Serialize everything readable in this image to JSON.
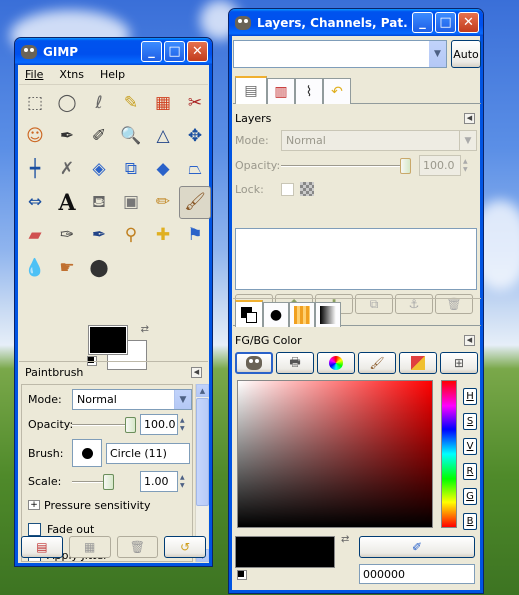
{
  "colors": {
    "title_blue": "#0053ee",
    "face": "#ece9d8",
    "fg": "#000000",
    "bg": "#ffffff"
  },
  "toolbox": {
    "title": "GIMP",
    "menu": [
      "File",
      "Xtns",
      "Help"
    ],
    "tools": [
      {
        "name": "rect-select-icon",
        "glyph": "⬚",
        "color": "#555"
      },
      {
        "name": "ellipse-select-icon",
        "glyph": "◯",
        "color": "#555"
      },
      {
        "name": "free-select-icon",
        "glyph": "ℓ",
        "color": "#666"
      },
      {
        "name": "fuzzy-select-icon",
        "glyph": "✎",
        "color": "#c8a020"
      },
      {
        "name": "select-by-color-icon",
        "glyph": "▦",
        "color": "#d04020"
      },
      {
        "name": "scissors-icon",
        "glyph": "✂",
        "color": "#aa2222"
      },
      {
        "name": "foreground-select-icon",
        "glyph": "☺",
        "color": "#cc6622"
      },
      {
        "name": "paths-icon",
        "glyph": "✒",
        "color": "#333"
      },
      {
        "name": "color-picker-icon",
        "glyph": "✐",
        "color": "#333"
      },
      {
        "name": "zoom-icon",
        "glyph": "🔍",
        "color": "#2255aa"
      },
      {
        "name": "measure-icon",
        "glyph": "△",
        "color": "#224488"
      },
      {
        "name": "move-icon",
        "glyph": "✥",
        "color": "#1a4fa0"
      },
      {
        "name": "align-icon",
        "glyph": "┿",
        "color": "#1a4fa0"
      },
      {
        "name": "crop-icon",
        "glyph": "✗",
        "color": "#666"
      },
      {
        "name": "rotate-icon",
        "glyph": "◈",
        "color": "#2a62c9"
      },
      {
        "name": "scale-icon",
        "glyph": "⧉",
        "color": "#2a62c9"
      },
      {
        "name": "shear-icon",
        "glyph": "◆",
        "color": "#2a62c9"
      },
      {
        "name": "perspective-icon",
        "glyph": "⏢",
        "color": "#2a62c9"
      },
      {
        "name": "flip-icon",
        "glyph": "⇔",
        "color": "#1a4fa0"
      },
      {
        "name": "text-icon",
        "glyph": "A",
        "color": "#111"
      },
      {
        "name": "bucket-fill-icon",
        "glyph": "⛾",
        "color": "#666"
      },
      {
        "name": "blend-icon",
        "glyph": "▣",
        "color": "#777"
      },
      {
        "name": "pencil-icon",
        "glyph": "✏",
        "color": "#c28a2a"
      },
      {
        "name": "paintbrush-icon",
        "glyph": "🖌",
        "color": "#8a5a2a"
      },
      {
        "name": "eraser-icon",
        "glyph": "▰",
        "color": "#d05050"
      },
      {
        "name": "airbrush-icon",
        "glyph": "✑",
        "color": "#444"
      },
      {
        "name": "ink-icon",
        "glyph": "✒",
        "color": "#224488"
      },
      {
        "name": "clone-icon",
        "glyph": "⚲",
        "color": "#c08020"
      },
      {
        "name": "heal-icon",
        "glyph": "✚",
        "color": "#e0b020"
      },
      {
        "name": "perspective-clone-icon",
        "glyph": "⚑",
        "color": "#2a62c9"
      },
      {
        "name": "blur-icon",
        "glyph": "💧",
        "color": "#3a7ad0"
      },
      {
        "name": "smudge-icon",
        "glyph": "☛",
        "color": "#c07030"
      },
      {
        "name": "dodge-burn-icon",
        "glyph": "⬤",
        "color": "#333"
      }
    ],
    "paintbrush": {
      "header": "Paintbrush",
      "mode_label": "Mode:",
      "mode_value": "Normal",
      "opacity_label": "Opacity:",
      "opacity_value": "100.0",
      "opacity_fraction": 1.0,
      "brush_label": "Brush:",
      "brush_value": "Circle (11)",
      "scale_label": "Scale:",
      "scale_value": "1.00",
      "pressure_label": "Pressure sensitivity",
      "fade_label": "Fade out",
      "jitter_label": "Apply Jitter"
    }
  },
  "dock": {
    "title": "Layers, Channels, Pat...",
    "auto_label": "Auto",
    "layers": {
      "header": "Layers",
      "mode_label": "Mode:",
      "mode_value": "Normal",
      "opacity_label": "Opacity:",
      "opacity_value": "100.0",
      "lock_label": "Lock:"
    },
    "fgbg": {
      "header": "FG/BG Color",
      "hex_value": "000000",
      "channels": [
        "H",
        "S",
        "V",
        "R",
        "G",
        "B"
      ]
    }
  }
}
